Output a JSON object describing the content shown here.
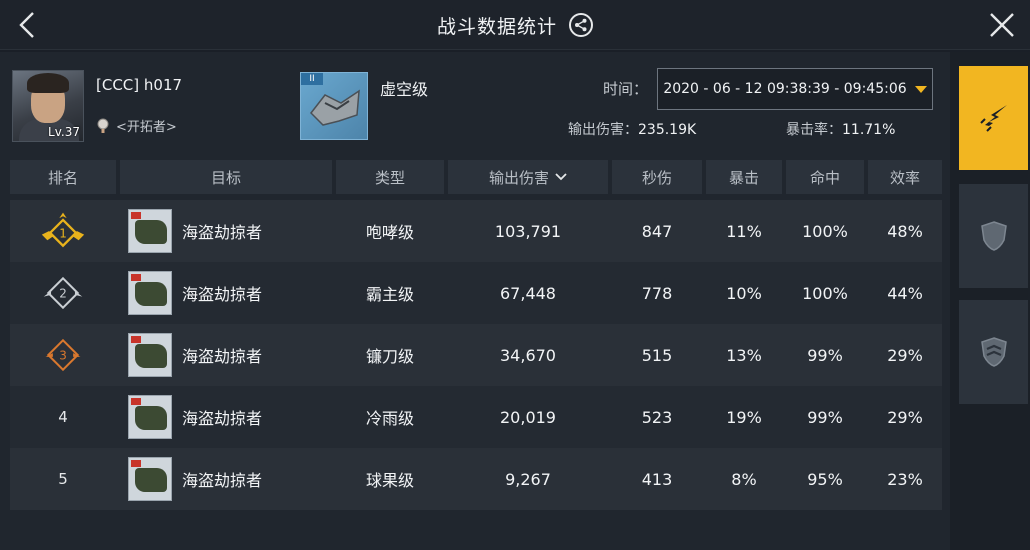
{
  "header": {
    "title": "战斗数据统计"
  },
  "player": {
    "name": "[CCC] h017",
    "level": "Lv.37",
    "rank": "<开拓者>"
  },
  "ship": {
    "tier": "II",
    "name": "虚空级"
  },
  "filters": {
    "time_label": "时间：",
    "time_range": "2020 - 06 - 12   09:38:39 - 09:45:06"
  },
  "summary": {
    "damage_label": "输出伤害：",
    "damage_value": "235.19K",
    "crit_label": "暴击率：",
    "crit_value": "11.71%"
  },
  "table": {
    "columns": [
      "排名",
      "目标",
      "类型",
      "输出伤害",
      "秒伤",
      "暴击",
      "命中",
      "效率"
    ],
    "rows": [
      {
        "rank": "1",
        "target": "海盗劫掠者",
        "type": "咆哮级",
        "damage": "103,791",
        "dps": "847",
        "crit": "11%",
        "hit": "100%",
        "eff": "48%"
      },
      {
        "rank": "2",
        "target": "海盗劫掠者",
        "type": "霸主级",
        "damage": "67,448",
        "dps": "778",
        "crit": "10%",
        "hit": "100%",
        "eff": "44%"
      },
      {
        "rank": "3",
        "target": "海盗劫掠者",
        "type": "镰刀级",
        "damage": "34,670",
        "dps": "515",
        "crit": "13%",
        "hit": "99%",
        "eff": "29%"
      },
      {
        "rank": "4",
        "target": "海盗劫掠者",
        "type": "冷雨级",
        "damage": "20,019",
        "dps": "523",
        "crit": "19%",
        "hit": "99%",
        "eff": "29%"
      },
      {
        "rank": "5",
        "target": "海盗劫掠者",
        "type": "球果级",
        "damage": "9,267",
        "dps": "413",
        "crit": "8%",
        "hit": "95%",
        "eff": "23%"
      }
    ]
  },
  "colors": {
    "accent": "#f2b621",
    "gold": "#e8b21c",
    "silver": "#c9ced3",
    "bronze": "#d9782e"
  },
  "icons": {
    "back": "chevron-left-icon",
    "close": "close-icon",
    "share": "share-icon",
    "sidebar": [
      "attack-icon",
      "shield-icon",
      "defense-icon"
    ]
  }
}
